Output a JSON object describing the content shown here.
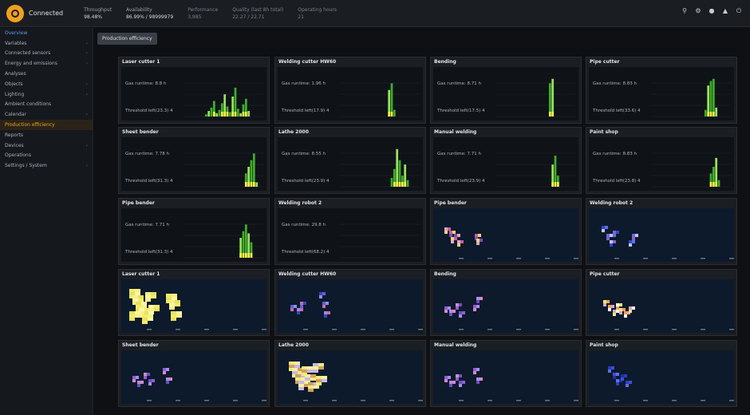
{
  "header": {
    "brand": "Connected",
    "stats": [
      {
        "label": "Throughput",
        "value": "98.48%"
      },
      {
        "label": "Availability",
        "value": "86.99% / 98999979"
      },
      {
        "label": "Performance",
        "value": "3,985"
      },
      {
        "label": "Quality (last 8h total)",
        "value": "22.27 / 22.71"
      },
      {
        "label": "Operating hours",
        "value": "21"
      }
    ],
    "icons": [
      "search-icon",
      "gear-icon",
      "user-icon",
      "bell-icon",
      "power-icon"
    ]
  },
  "sidebar": {
    "items": [
      {
        "label": "Overview",
        "header": true,
        "arrow": false
      },
      {
        "label": "Variables",
        "arrow": true
      },
      {
        "label": "Connected sensors",
        "arrow": true
      },
      {
        "label": "Energy and emissions",
        "arrow": true
      },
      {
        "label": "Analyses",
        "arrow": false
      },
      {
        "label": "Objects",
        "arrow": true
      },
      {
        "label": "Lighting",
        "arrow": true
      },
      {
        "label": "Ambient conditions",
        "arrow": false
      },
      {
        "label": "Calendar",
        "arrow": true
      },
      {
        "label": "Production efficiency",
        "active": true,
        "arrow": false
      },
      {
        "label": "Reports",
        "arrow": false
      },
      {
        "label": "Devices",
        "arrow": true
      },
      {
        "label": "Operations",
        "arrow": false
      },
      {
        "label": "Settings / System",
        "arrow": true
      }
    ]
  },
  "tab": {
    "label": "Production efficiency"
  },
  "panels_row1": [
    {
      "title": "Laser cutter 1",
      "stat1": "Gas runtime: 8.8 h",
      "stat2": "Threshold left(23.3) 4",
      "bars": [
        0,
        0,
        0,
        0,
        0,
        0,
        0,
        0,
        2,
        5,
        8,
        14,
        3,
        6,
        12,
        20,
        9,
        4,
        18,
        26,
        7,
        3,
        11,
        16,
        5,
        0,
        0,
        0,
        0,
        0
      ]
    },
    {
      "title": "Welding cutter HW60",
      "stat1": "Gas runtime: 1.96 h",
      "stat2": "Threshold left(17.9) 4",
      "bars": [
        0,
        0,
        0,
        0,
        0,
        0,
        0,
        0,
        0,
        0,
        0,
        0,
        0,
        0,
        0,
        0,
        0,
        0,
        24,
        30,
        6,
        0,
        0,
        0,
        0,
        0,
        0,
        0,
        0,
        0
      ]
    },
    {
      "title": "Bending",
      "stat1": "Gas runtime: 8.71 h",
      "stat2": "Threshold left(17.5) 4",
      "bars": [
        0,
        0,
        0,
        0,
        0,
        0,
        0,
        0,
        0,
        0,
        0,
        0,
        0,
        0,
        0,
        0,
        0,
        0,
        0,
        0,
        30,
        34,
        0,
        0,
        0,
        0,
        0,
        0,
        0,
        0
      ]
    },
    {
      "title": "Pipe cutter",
      "stat1": "Gas runtime: 8.83 h",
      "stat2": "Threshold left(33.6) 4",
      "bars": [
        0,
        0,
        0,
        0,
        0,
        0,
        0,
        0,
        0,
        0,
        0,
        0,
        0,
        0,
        0,
        0,
        0,
        0,
        0,
        0,
        6,
        28,
        32,
        34,
        8,
        0,
        0,
        0,
        0,
        0
      ]
    }
  ],
  "panels_row2": [
    {
      "title": "Sheet bender",
      "stat1": "Gas runtime: 7.78 h",
      "stat2": "Threshold left(31.3) 4",
      "bars": [
        0,
        0,
        0,
        0,
        0,
        0,
        0,
        0,
        0,
        0,
        0,
        0,
        0,
        0,
        0,
        0,
        0,
        0,
        0,
        0,
        0,
        0,
        0,
        12,
        18,
        24,
        30,
        4,
        0,
        0
      ]
    },
    {
      "title": "Lathe 2000",
      "stat1": "Gas runtime: 8.55 h",
      "stat2": "Threshold left(23.9) 4",
      "bars": [
        0,
        0,
        0,
        0,
        0,
        0,
        0,
        0,
        0,
        0,
        0,
        0,
        0,
        0,
        0,
        0,
        0,
        0,
        0,
        8,
        16,
        34,
        24,
        10,
        20,
        6,
        0,
        0,
        0,
        0
      ]
    },
    {
      "title": "Manual welding",
      "stat1": "Gas runtime: 7.71 h",
      "stat2": "Threshold left(23.9) 4",
      "bars": [
        0,
        0,
        0,
        0,
        0,
        0,
        0,
        0,
        0,
        0,
        0,
        0,
        0,
        0,
        0,
        0,
        0,
        0,
        0,
        0,
        0,
        20,
        28,
        10,
        0,
        0,
        0,
        0,
        0,
        0
      ]
    },
    {
      "title": "Paint shop",
      "stat1": "Gas runtime: 8.83 h",
      "stat2": "Threshold left(23.8) 4",
      "bars": [
        0,
        0,
        0,
        0,
        0,
        0,
        0,
        0,
        0,
        0,
        0,
        0,
        0,
        0,
        0,
        0,
        0,
        0,
        0,
        0,
        0,
        0,
        12,
        18,
        26,
        6,
        0,
        0,
        0,
        0
      ]
    }
  ],
  "panels_row3_bar": [
    {
      "title": "Pipe bender",
      "stat1": "Gas runtime: 7.71 h",
      "stat2": "Threshold left(31.3) 4",
      "bars": [
        0,
        0,
        0,
        0,
        0,
        0,
        0,
        0,
        0,
        0,
        0,
        0,
        0,
        0,
        0,
        0,
        0,
        0,
        0,
        0,
        0,
        18,
        24,
        30,
        22,
        14,
        0,
        0,
        0,
        0
      ]
    },
    {
      "title": "Welding robot 2",
      "stat1": "Gas runtime: 29.8 h",
      "stat2": "Threshold left(68.2) 4",
      "bars": [
        0,
        0,
        0,
        0,
        0,
        0,
        0,
        0,
        0,
        0,
        0,
        0,
        0,
        0,
        0,
        0,
        0,
        0,
        0,
        0,
        0,
        0,
        0,
        0,
        0,
        0,
        0,
        0,
        0,
        0
      ]
    }
  ],
  "panels_heat": [
    {
      "title": "Pipe bender",
      "pattern": "pink"
    },
    {
      "title": "Welding robot 2",
      "pattern": "blue"
    },
    {
      "title": "Laser cutter 1",
      "pattern": "yellow"
    },
    {
      "title": "Welding cutter HW60",
      "pattern": "blue2"
    },
    {
      "title": "Bending",
      "pattern": "purple"
    },
    {
      "title": "Pipe cutter",
      "pattern": "mixed"
    },
    {
      "title": "Sheet bender",
      "pattern": "purple"
    },
    {
      "title": "Lathe 2000",
      "pattern": "yellow2"
    },
    {
      "title": "Manual welding",
      "pattern": "purple"
    },
    {
      "title": "Paint shop",
      "pattern": "dblue"
    }
  ],
  "colors": {
    "accent": "#f0a020",
    "bar_green": "#3fae2a",
    "bar_light": "#9be15d",
    "bar_yellow": "#f5f04a",
    "heat_bg": "#0d1a2b"
  }
}
